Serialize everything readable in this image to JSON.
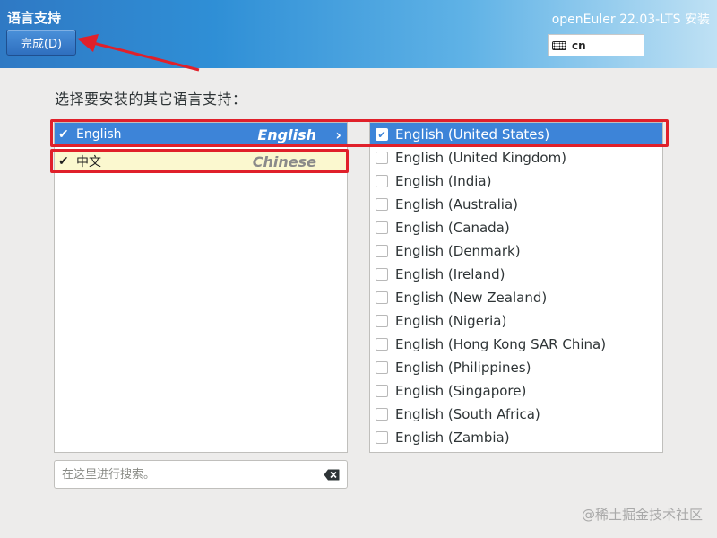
{
  "header": {
    "title": "语言支持",
    "done_label": "完成(D)",
    "product": "openEuler 22.03-LTS 安装",
    "keyboard": {
      "icon": "keyboard-icon",
      "layout": "cn"
    }
  },
  "prompt": "选择要安装的其它语言支持：",
  "languages": [
    {
      "native": "English",
      "english": "English",
      "checked": true,
      "selected": true
    },
    {
      "native": "中文",
      "english": "Chinese",
      "checked": true,
      "selected": false
    }
  ],
  "locales": [
    {
      "label": "English (United States)",
      "checked": true
    },
    {
      "label": "English (United Kingdom)",
      "checked": false
    },
    {
      "label": "English (India)",
      "checked": false
    },
    {
      "label": "English (Australia)",
      "checked": false
    },
    {
      "label": "English (Canada)",
      "checked": false
    },
    {
      "label": "English (Denmark)",
      "checked": false
    },
    {
      "label": "English (Ireland)",
      "checked": false
    },
    {
      "label": "English (New Zealand)",
      "checked": false
    },
    {
      "label": "English (Nigeria)",
      "checked": false
    },
    {
      "label": "English (Hong Kong SAR China)",
      "checked": false
    },
    {
      "label": "English (Philippines)",
      "checked": false
    },
    {
      "label": "English (Singapore)",
      "checked": false
    },
    {
      "label": "English (South Africa)",
      "checked": false
    },
    {
      "label": "English (Zambia)",
      "checked": false
    }
  ],
  "search": {
    "placeholder": "在这里进行搜索。",
    "value": ""
  },
  "watermark": "@稀土掘金技术社区",
  "colors": {
    "accent": "#3d84d8",
    "annotation": "#e0202a",
    "highlight": "#fbf8cf"
  }
}
